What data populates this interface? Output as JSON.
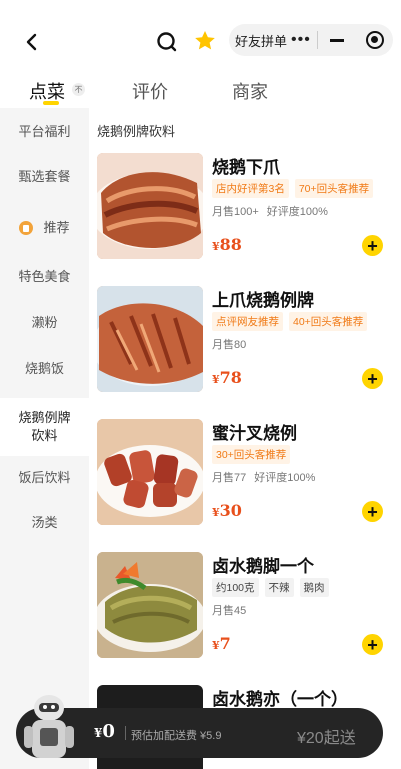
{
  "header": {
    "capsule_text": "好友拼单",
    "capsule_dots": "•••"
  },
  "tabs": [
    {
      "label": "点菜",
      "badge": "不",
      "active": true
    },
    {
      "label": "评价",
      "active": false
    },
    {
      "label": "商家",
      "active": false
    }
  ],
  "sidebar": {
    "items": [
      {
        "label": "平台福利"
      },
      {
        "label": "甄选套餐"
      },
      {
        "label": "推荐",
        "icon": "recommend-icon"
      },
      {
        "label": "特色美食"
      },
      {
        "label": "濑粉"
      },
      {
        "label": "烧鹅饭"
      },
      {
        "label": "烧鹅例牌\n砍料",
        "active": true
      },
      {
        "label": "饭后饮料"
      },
      {
        "label": "汤类"
      }
    ]
  },
  "main": {
    "category_title": "烧鹅例牌砍料",
    "dishes": [
      {
        "name": "烧鹅下爪",
        "tags": [
          {
            "text": "店内好评第3名",
            "style": "orange"
          },
          {
            "text": "70+回头客推荐",
            "style": "orange"
          }
        ],
        "sales": [
          "月售100+",
          "好评度100%"
        ],
        "currency": "¥",
        "price": "88"
      },
      {
        "name": "上爪烧鹅例牌",
        "tags": [
          {
            "text": "点评网友推荐",
            "style": "orange"
          },
          {
            "text": "40+回头客推荐",
            "style": "orange"
          }
        ],
        "sales": [
          "月售80"
        ],
        "currency": "¥",
        "price": "78"
      },
      {
        "name": "蜜汁叉烧例",
        "tags": [
          {
            "text": "30+回头客推荐",
            "style": "orange"
          }
        ],
        "sales": [
          "月售77",
          "好评度100%"
        ],
        "currency": "¥",
        "price": "30"
      },
      {
        "name": "卤水鹅脚一个",
        "tags": [
          {
            "text": "约100克",
            "style": "gray"
          },
          {
            "text": "不辣",
            "style": "gray"
          },
          {
            "text": "鹅肉",
            "style": "gray"
          }
        ],
        "sales": [
          "月售45"
        ],
        "currency": "¥",
        "price": "7"
      },
      {
        "name": "卤水鹅亦（一个）",
        "tags": [],
        "sales": [],
        "currency": "",
        "price": ""
      }
    ]
  },
  "cart": {
    "currency": "¥",
    "total": "0",
    "delivery_fee": "预估加配送费 ¥5.9",
    "min_order": "¥20起送"
  },
  "colors": {
    "accent_yellow": "#ffd400",
    "price_red": "#e8501c",
    "tag_orange": "#f07a16",
    "cart_bg": "#252525"
  }
}
